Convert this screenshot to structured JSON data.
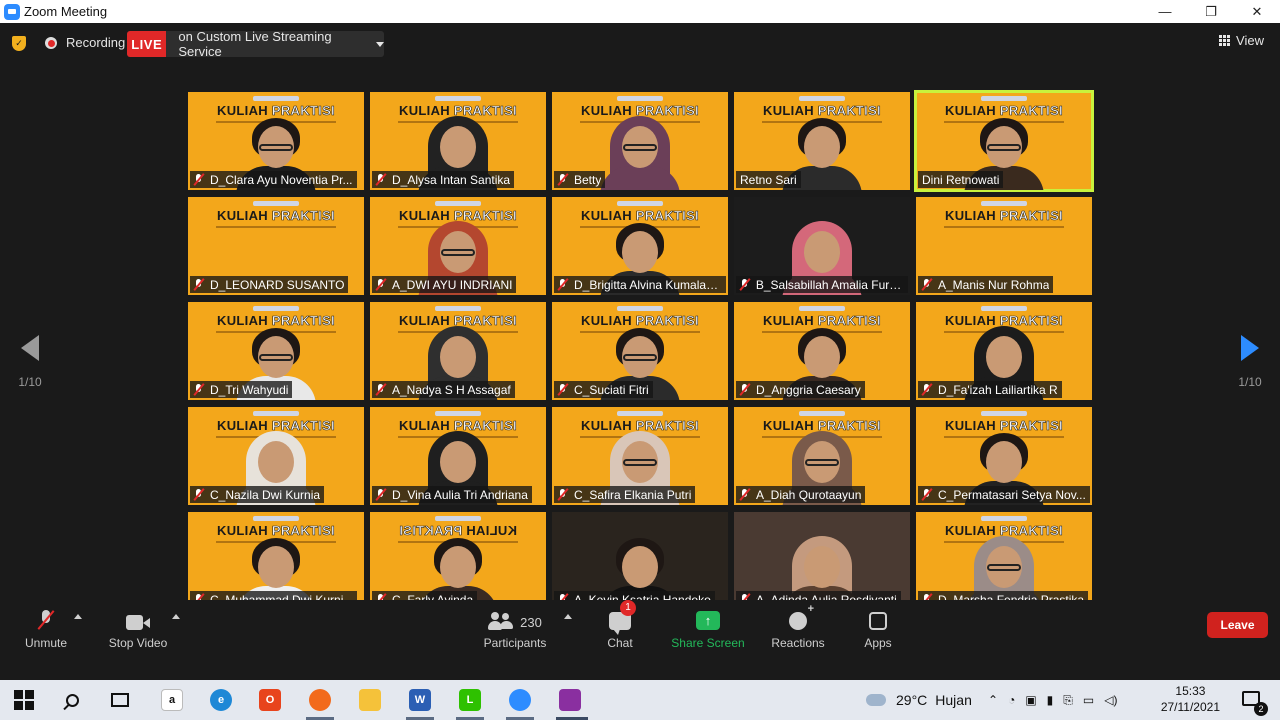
{
  "window": {
    "title": "Zoom Meeting",
    "buttons": {
      "minimize": "—",
      "restore": "❐",
      "close": "✕"
    }
  },
  "status_bar": {
    "recording_label": "Recording",
    "live_badge": "LIVE",
    "live_target": "on Custom Live Streaming Service",
    "view_label": "View"
  },
  "pager": {
    "left_page": "1/10",
    "right_page": "1/10"
  },
  "participants_grid": [
    {
      "name": "D_Clara Ayu Noventia Pr...",
      "muted": true,
      "active": false
    },
    {
      "name": "D_Alysa Intan Santika",
      "muted": true,
      "active": false
    },
    {
      "name": "Betty",
      "muted": true,
      "active": false
    },
    {
      "name": "Retno Sari",
      "muted": false,
      "active": false
    },
    {
      "name": "Dini Retnowati",
      "muted": false,
      "active": true
    },
    {
      "name": "D_LEONARD SUSANTO",
      "muted": true,
      "active": false
    },
    {
      "name": "A_DWI AYU INDRIANI",
      "muted": true,
      "active": false
    },
    {
      "name": "D_Brigitta Alvina Kumalas...",
      "muted": true,
      "active": false
    },
    {
      "name": "B_Salsabillah Amalia Furti...",
      "muted": true,
      "active": false
    },
    {
      "name": "A_Manis Nur Rohma",
      "muted": true,
      "active": false
    },
    {
      "name": "D_Tri Wahyudi",
      "muted": true,
      "active": false
    },
    {
      "name": "A_Nadya S H Assagaf",
      "muted": true,
      "active": false
    },
    {
      "name": "C_Suciati Fitri",
      "muted": true,
      "active": false
    },
    {
      "name": "D_Anggria Caesary",
      "muted": true,
      "active": false
    },
    {
      "name": "D_Fa'izah Lailiartika R",
      "muted": true,
      "active": false
    },
    {
      "name": "C_Nazila Dwi Kurnia",
      "muted": true,
      "active": false
    },
    {
      "name": "D_Vina Aulia Tri Andriana",
      "muted": true,
      "active": false
    },
    {
      "name": "C_Safira Elkania Putri",
      "muted": true,
      "active": false
    },
    {
      "name": "A_Diah Qurotaayun",
      "muted": true,
      "active": false
    },
    {
      "name": "C_Permatasari Setya Nov...",
      "muted": true,
      "active": false
    },
    {
      "name": "C_Muhammad Dwi Kurni...",
      "muted": true,
      "active": false
    },
    {
      "name": "C_Farly Avinda",
      "muted": true,
      "active": false
    },
    {
      "name": "A_Kevin Ksatria Handoko",
      "muted": true,
      "active": false
    },
    {
      "name": "A_Adinda Aulia Rosdiyanti",
      "muted": true,
      "active": false
    },
    {
      "name": "D_Marsha Fendria Prastika",
      "muted": true,
      "active": false
    }
  ],
  "banner": {
    "word1": "KULIAH",
    "word2": "PRAKTISI"
  },
  "toolbar": {
    "unmute": "Unmute",
    "stop_video": "Stop Video",
    "participants_count": "230",
    "participants": "Participants",
    "chat": "Chat",
    "chat_badge": "1",
    "share_screen": "Share Screen",
    "reactions": "Reactions",
    "apps": "Apps",
    "leave": "Leave"
  },
  "taskbar": {
    "weather_temp": "29°C",
    "weather_desc": "Hujan",
    "time": "15:33",
    "date": "27/11/2021",
    "notification_count": "2"
  },
  "colors": {
    "accent_blue": "#2d8cff",
    "live_red": "#e02828",
    "share_green": "#23b85a",
    "banner_yellow": "#f3a71b",
    "active_speaker": "#c9f23d"
  }
}
